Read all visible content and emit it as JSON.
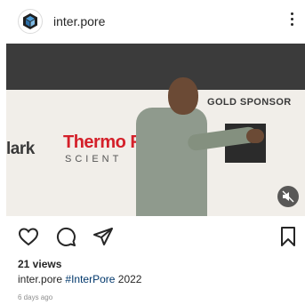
{
  "header": {
    "username": "inter.pore"
  },
  "media": {
    "banner_text": {
      "left_brand": "lark",
      "thermo": "Thermo F",
      "scientific": "SCIENT",
      "gold_sponsor": "GOLD SPONSOR"
    }
  },
  "stats": {
    "views": "21 views"
  },
  "caption": {
    "username": "inter.pore",
    "hashtag": "#InterPore",
    "rest": " 2022"
  },
  "time": "6 days ago"
}
